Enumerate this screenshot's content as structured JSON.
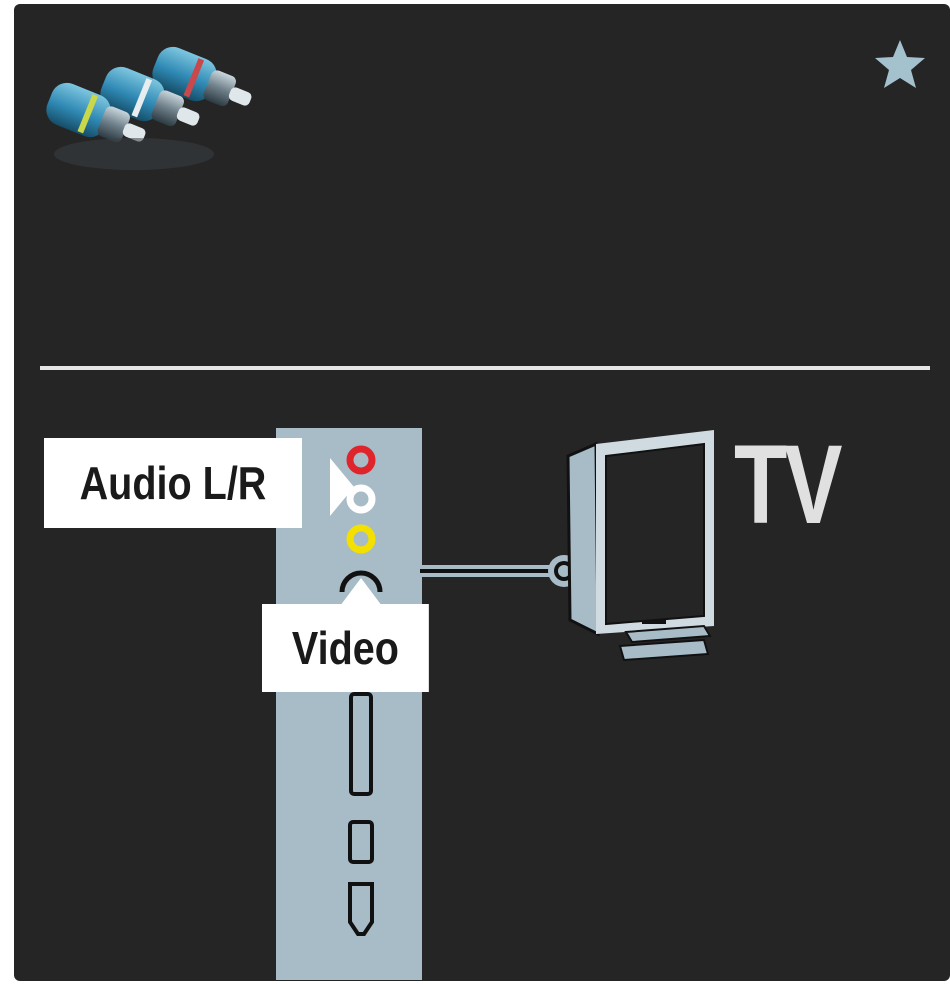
{
  "labels": {
    "audio": "Audio L/R",
    "video": "Video",
    "tv": "TV"
  },
  "icons": {
    "cables": "rca-cables-icon",
    "favorite": "star-icon"
  },
  "colors": {
    "background": "#252525",
    "panel": "#a7bcc7",
    "audio_left": "#ffffff",
    "audio_right": "#e0242b",
    "video": "#f3e000"
  }
}
